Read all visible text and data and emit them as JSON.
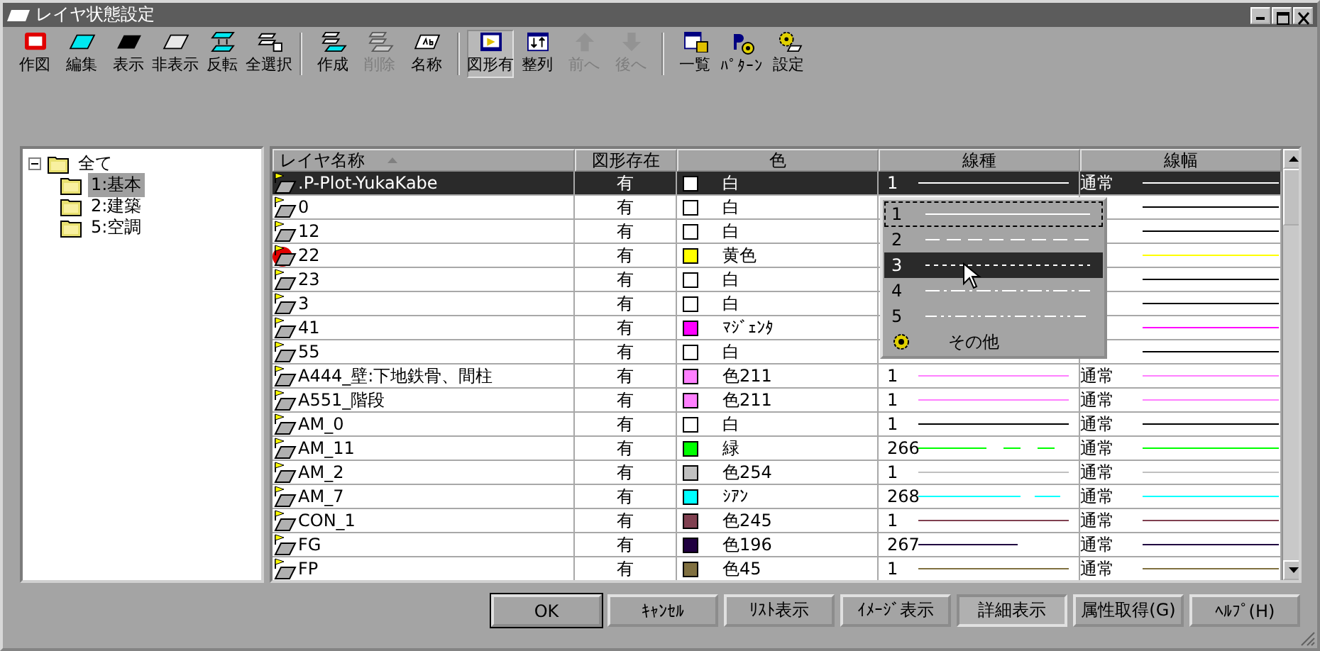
{
  "window": {
    "title": "レイヤ状態設定"
  },
  "toolbar": [
    {
      "label": "作図",
      "disabled": false,
      "pressed": false
    },
    {
      "label": "編集",
      "disabled": false,
      "pressed": false
    },
    {
      "label": "表示",
      "disabled": false,
      "pressed": false
    },
    {
      "label": "非表示",
      "disabled": false,
      "pressed": false
    },
    {
      "label": "反転",
      "disabled": false,
      "pressed": false
    },
    {
      "label": "全選択",
      "disabled": false,
      "pressed": false,
      "group_end": true
    },
    {
      "label": "作成",
      "disabled": false,
      "pressed": false
    },
    {
      "label": "削除",
      "disabled": true,
      "pressed": false
    },
    {
      "label": "名称",
      "disabled": false,
      "pressed": false,
      "group_end": true
    },
    {
      "label": "図形有",
      "disabled": false,
      "pressed": true
    },
    {
      "label": "整列",
      "disabled": false,
      "pressed": false
    },
    {
      "label": "前へ",
      "disabled": true,
      "pressed": false
    },
    {
      "label": "後へ",
      "disabled": true,
      "pressed": false,
      "group_end": true
    },
    {
      "label": "一覧",
      "disabled": false,
      "pressed": false
    },
    {
      "label": "ﾊﾟﾀｰﾝ",
      "disabled": false,
      "pressed": false
    },
    {
      "label": "設定",
      "disabled": false,
      "pressed": false
    }
  ],
  "tree": {
    "label": "全て",
    "expanded": true,
    "children": [
      {
        "label": "1:基本",
        "selected": true
      },
      {
        "label": "2:建築",
        "selected": false
      },
      {
        "label": "5:空調",
        "selected": false
      }
    ]
  },
  "table": {
    "columns": [
      {
        "label": "レイヤ名称",
        "sorted": true
      },
      {
        "label": "図形存在",
        "sorted": false
      },
      {
        "label": "色",
        "sorted": false
      },
      {
        "label": "線種",
        "sorted": false
      },
      {
        "label": "線幅",
        "sorted": false
      }
    ],
    "rows": [
      {
        "name": ".P-Plot-YukaKabe",
        "exists": "有",
        "color": "#ffffff",
        "color_name": "白",
        "linetype": "1",
        "line": {
          "kind": "solid",
          "color": "#ffffff"
        },
        "width": "通常",
        "selected": true,
        "marked": false
      },
      {
        "name": "0",
        "exists": "有",
        "color": "#ffffff",
        "color_name": "白",
        "line": {
          "color": "#000000"
        },
        "selected": false,
        "marked": false
      },
      {
        "name": "12",
        "exists": "有",
        "color": "#ffffff",
        "color_name": "白",
        "line": {
          "color": "#000000"
        },
        "selected": false,
        "marked": false
      },
      {
        "name": "22",
        "exists": "有",
        "color": "#ffff00",
        "color_name": "黄色",
        "line": {
          "color": "#ffff00"
        },
        "selected": false,
        "marked": true
      },
      {
        "name": "23",
        "exists": "有",
        "color": "#ffffff",
        "color_name": "白",
        "line": {
          "color": "#000000"
        },
        "selected": false,
        "marked": false
      },
      {
        "name": "3",
        "exists": "有",
        "color": "#ffffff",
        "color_name": "白",
        "line": {
          "color": "#000000"
        },
        "selected": false,
        "marked": false
      },
      {
        "name": "41",
        "exists": "有",
        "color": "#ff00ff",
        "color_name": "ﾏｼﾞｪﾝﾀ",
        "line": {
          "color": "#ff00ff"
        },
        "selected": false,
        "marked": false
      },
      {
        "name": "55",
        "exists": "有",
        "color": "#ffffff",
        "color_name": "白",
        "line": {
          "color": "#000000"
        },
        "selected": false,
        "marked": false
      },
      {
        "name": "A444_壁:下地鉄骨、間柱",
        "exists": "有",
        "color": "#ff80ff",
        "color_name": "色211",
        "linetype": "1",
        "line": {
          "kind": "solid",
          "color": "#ff80ff"
        },
        "width": "通常",
        "selected": false,
        "marked": false
      },
      {
        "name": "A551_階段",
        "exists": "有",
        "color": "#ff80ff",
        "color_name": "色211",
        "linetype": "1",
        "line": {
          "kind": "solid",
          "color": "#ff80ff"
        },
        "width": "通常",
        "selected": false,
        "marked": false
      },
      {
        "name": "AM_0",
        "exists": "有",
        "color": "#ffffff",
        "color_name": "白",
        "linetype": "1",
        "line": {
          "kind": "solid",
          "color": "#000000"
        },
        "width": "通常",
        "selected": false,
        "marked": false
      },
      {
        "name": "AM_11",
        "exists": "有",
        "color": "#00ff00",
        "color_name": "緑",
        "linetype": "266",
        "line": {
          "kind": "longgap",
          "color": "#00ff00"
        },
        "width": "通常",
        "selected": false,
        "marked": false
      },
      {
        "name": "AM_2",
        "exists": "有",
        "color": "#c0c0c0",
        "color_name": "色254",
        "linetype": "1",
        "line": {
          "kind": "solid",
          "color": "#c0c0c0"
        },
        "width": "通常",
        "selected": false,
        "marked": false
      },
      {
        "name": "AM_7",
        "exists": "有",
        "color": "#00ffff",
        "color_name": "ｼｱﾝ",
        "linetype": "268",
        "line": {
          "kind": "dashgap",
          "color": "#00ffff"
        },
        "width": "通常",
        "selected": false,
        "marked": false
      },
      {
        "name": "CON_1",
        "exists": "有",
        "color": "#804050",
        "color_name": "色245",
        "linetype": "1",
        "line": {
          "kind": "solid",
          "color": "#804050"
        },
        "width": "通常",
        "selected": false,
        "marked": false
      },
      {
        "name": "FG",
        "exists": "有",
        "color": "#200040",
        "color_name": "色196",
        "linetype": "267",
        "line": {
          "kind": "short",
          "color": "#200040"
        },
        "width": "通常",
        "selected": false,
        "marked": false
      },
      {
        "name": "FP",
        "exists": "有",
        "color": "#807040",
        "color_name": "色45",
        "linetype": "1",
        "line": {
          "kind": "solid",
          "color": "#807040"
        },
        "width": "通常",
        "selected": false,
        "marked": false
      }
    ]
  },
  "linetype_menu": {
    "items": [
      {
        "kind": "pattern",
        "label": "1",
        "line": {
          "kind": "solid"
        },
        "selected": false,
        "focused": true
      },
      {
        "kind": "pattern",
        "label": "2",
        "line": {
          "kind": "dash"
        },
        "selected": false,
        "focused": false
      },
      {
        "kind": "pattern",
        "label": "3",
        "line": {
          "kind": "dot"
        },
        "selected": true,
        "focused": false
      },
      {
        "kind": "pattern",
        "label": "4",
        "line": {
          "kind": "dashdot"
        },
        "selected": false,
        "focused": false
      },
      {
        "kind": "pattern",
        "label": "5",
        "line": {
          "kind": "dashdotdot"
        },
        "selected": false,
        "focused": false
      },
      {
        "kind": "other",
        "label": "その他",
        "selected": false,
        "focused": false
      }
    ]
  },
  "buttons": [
    {
      "label": "OK",
      "default": true,
      "pressed": false
    },
    {
      "label": "ｷｬﾝｾﾙ",
      "default": false,
      "pressed": false
    },
    {
      "label": "ﾘｽﾄ表示",
      "default": false,
      "pressed": false
    },
    {
      "label": "ｲﾒｰｼﾞ表示",
      "default": false,
      "pressed": false
    },
    {
      "label": "詳細表示",
      "default": false,
      "pressed": true
    },
    {
      "label": "属性取得(G)",
      "default": false,
      "pressed": false
    },
    {
      "label": "ﾍﾙﾌﾟ(H)",
      "default": false,
      "pressed": false
    }
  ]
}
